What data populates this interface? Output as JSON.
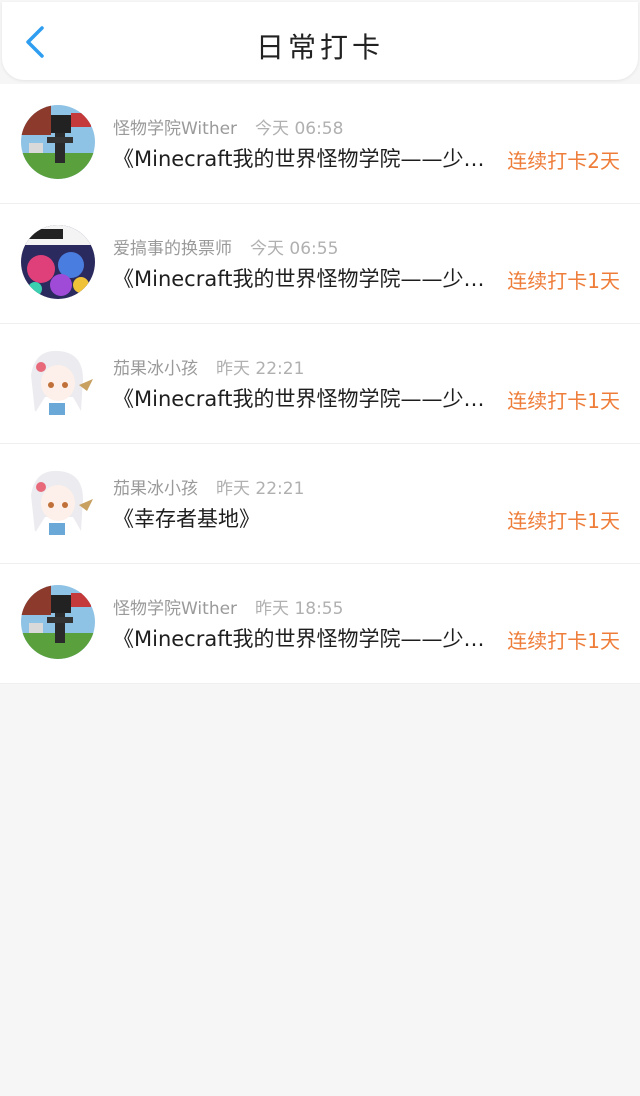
{
  "header": {
    "title": "日常打卡",
    "back_icon": "chevron-left-icon",
    "accent": "#2f9ef0"
  },
  "checkins": [
    {
      "user": "怪物学院Wither",
      "time": "今天 06:58",
      "book": "《Minecraft我的世界怪物学院——少年冒险之旅》",
      "streak": "连续打卡2天",
      "avatar_icon": "minecraft-wither-avatar-icon"
    },
    {
      "user": "爱搞事的换票师",
      "time": "今天 06:55",
      "book": "《Minecraft我的世界怪物学院——少年冒险之旅》",
      "streak": "连续打卡1天",
      "avatar_icon": "colorful-game-avatar-icon"
    },
    {
      "user": "茄果冰小孩",
      "time": "昨天 22:21",
      "book": "《Minecraft我的世界怪物学院——少年冒险之旅》",
      "streak": "连续打卡1天",
      "avatar_icon": "anime-girl-avatar-icon"
    },
    {
      "user": "茄果冰小孩",
      "time": "昨天 22:21",
      "book": "《幸存者基地》",
      "streak": "连续打卡1天",
      "avatar_icon": "anime-girl-avatar-icon"
    },
    {
      "user": "怪物学院Wither",
      "time": "昨天 18:55",
      "book": "《Minecraft我的世界怪物学院——少年冒险之旅》",
      "streak": "连续打卡1天",
      "avatar_icon": "minecraft-wither-avatar-icon"
    }
  ],
  "colors": {
    "streak": "#ee7d3a",
    "username": "#9a9a9a",
    "book_title": "#1e1e1e",
    "background": "#f7f6f6"
  }
}
